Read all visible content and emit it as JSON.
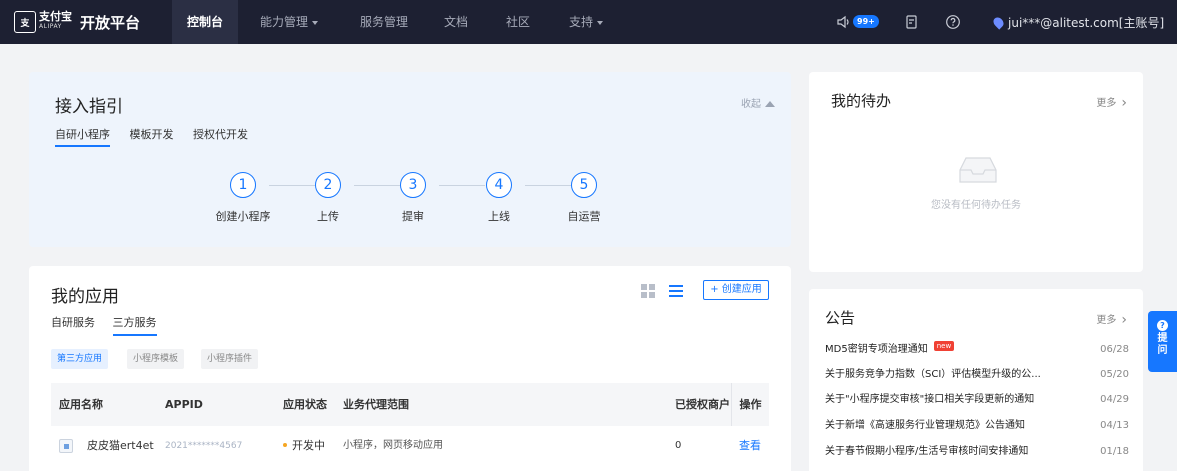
{
  "header": {
    "logo_cn": "支付宝",
    "logo_en": "ALIPAY",
    "platform": "开放平台",
    "nav": [
      {
        "label": "控制台"
      },
      {
        "label": "能力管理"
      },
      {
        "label": "服务管理"
      },
      {
        "label": "文档"
      },
      {
        "label": "社区"
      },
      {
        "label": "支持"
      }
    ],
    "badge": "99+",
    "user": "jui***@alitest.com[主账号]"
  },
  "guide": {
    "title": "接入指引",
    "collapse": "收起",
    "tabs": [
      "自研小程序",
      "模板开发",
      "授权代开发"
    ],
    "steps": [
      {
        "num": "1",
        "label": "创建小程序"
      },
      {
        "num": "2",
        "label": "上传"
      },
      {
        "num": "3",
        "label": "提审"
      },
      {
        "num": "4",
        "label": "上线"
      },
      {
        "num": "5",
        "label": "自运营"
      }
    ]
  },
  "apps": {
    "title": "我的应用",
    "create": "+ 创建应用",
    "tabs": [
      "自研服务",
      "三方服务"
    ],
    "filters": [
      "第三方应用",
      "小程序模板",
      "小程序插件"
    ],
    "columns": {
      "name": "应用名称",
      "appid": "APPID",
      "status": "应用状态",
      "scope": "业务代理范围",
      "merchants": "已授权商户",
      "actions": "操作"
    },
    "rows": [
      {
        "name": "皮皮猫ert4et",
        "appid": "2021*******4567",
        "status": "开发中",
        "scope": "小程序，网页移动应用",
        "merchants": "0",
        "action": "查看"
      }
    ]
  },
  "todo": {
    "title": "我的待办",
    "more": "更多",
    "empty": "您没有任何待办任务"
  },
  "notices": {
    "title": "公告",
    "more": "更多",
    "new_tag": "new",
    "items": [
      {
        "text": "MD5密钥专项治理通知",
        "date": "06/28"
      },
      {
        "text": "关于服务竞争力指数（SCI）评估模型升级的公...",
        "date": "05/20"
      },
      {
        "text": "关于\"小程序提交审核\"接口相关字段更新的通知",
        "date": "04/29"
      },
      {
        "text": "关于新增《高速服务行业管理规范》公告通知",
        "date": "04/13"
      },
      {
        "text": "关于春节假期小程序/生活号审核时间安排通知",
        "date": "01/18"
      }
    ]
  },
  "float_help": "提问"
}
